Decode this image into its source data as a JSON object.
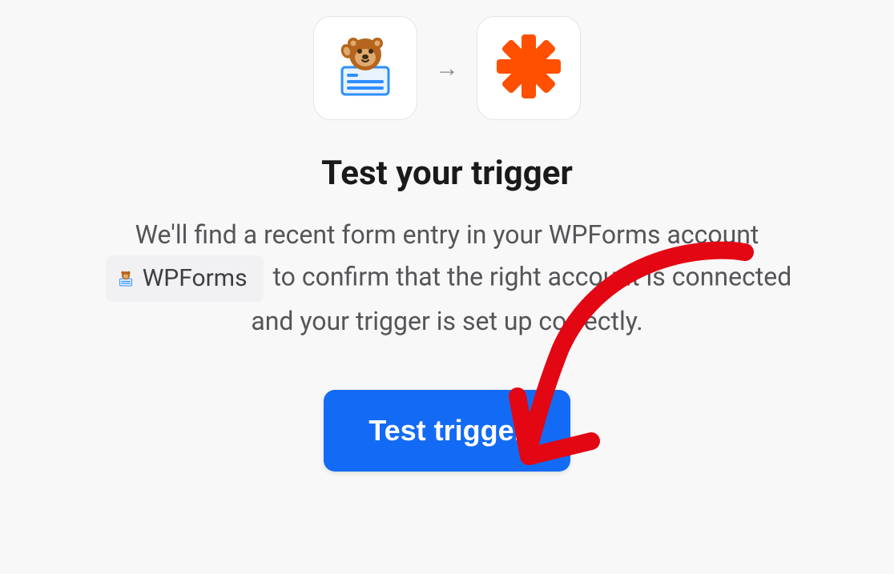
{
  "apps": {
    "source": {
      "name": "WPForms"
    },
    "target": {
      "name": "Zapier"
    }
  },
  "heading": "Test your trigger",
  "description": {
    "part1": "We'll find a recent form entry in your WPForms account ",
    "chip_label": "WPForms",
    "part2": " to confirm that the right account is connected and your trigger is set up correctly."
  },
  "cta": {
    "label": "Test trigger"
  }
}
